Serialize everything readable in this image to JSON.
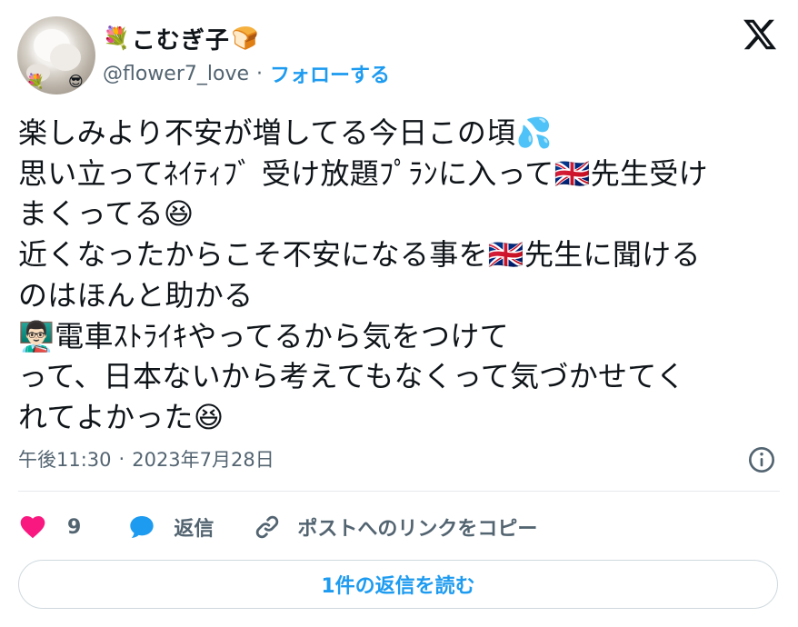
{
  "author": {
    "display_name": "こむぎ子",
    "name_prefix_emoji": "💐",
    "name_suffix_emoji": "🍞",
    "handle": "@flower7_love",
    "separator": "·",
    "follow_label": "フォローする",
    "avatar_emoji_left": "💐",
    "avatar_emoji_right": "😎"
  },
  "platform_icon": "x-logo-icon",
  "tweet": {
    "lines": [
      "楽しみより不安が増してる今日この頃💦",
      "思い立ってﾈｲﾃｨﾌﾞ 受け放題ﾌﾟﾗﾝに入って🇬🇧先生受け",
      "まくってる😆",
      "近くなったからこそ不安になる事を🇬🇧先生に聞ける",
      "のはほんと助かる",
      "👨🏻‍🏫電車ｽﾄﾗｲｷやってるから気をつけて",
      "って、日本ないから考えてもなくって気づかせてく",
      "れてよかった😆"
    ]
  },
  "meta": {
    "time": "午後11:30",
    "separator": "·",
    "date": "2023年7月28日"
  },
  "actions": {
    "like_count": "9",
    "reply_label": "返信",
    "copy_link_label": "ポストへのリンクをコピー"
  },
  "read_replies_label": "1件の返信を読む",
  "colors": {
    "accent": "#1d9bf0",
    "like": "#f91880",
    "secondary_text": "#536471",
    "text": "#0f1419",
    "border": "#cfd9de"
  },
  "icons": [
    "x-logo-icon",
    "info-icon",
    "heart-icon",
    "reply-bubble-icon",
    "link-icon"
  ]
}
